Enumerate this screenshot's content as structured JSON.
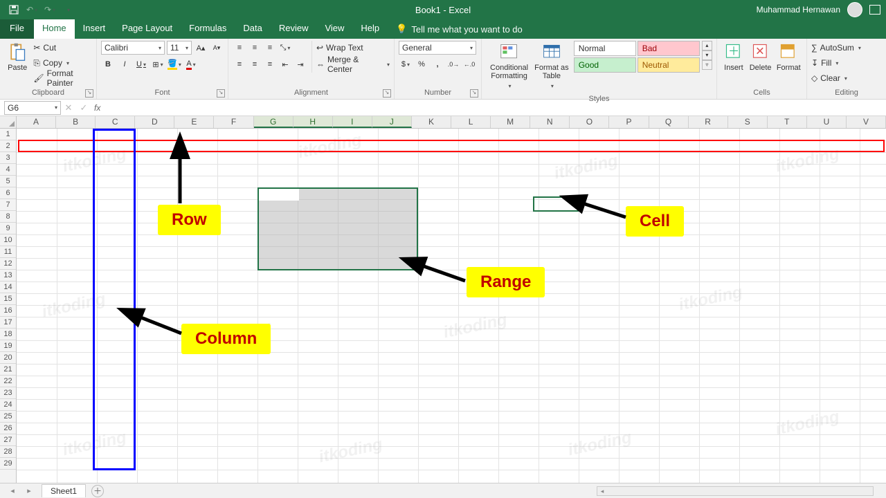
{
  "titlebar": {
    "document": "Book1  -  Excel",
    "user": "Muhammad Hernawan"
  },
  "tabs": {
    "file": "File",
    "list": [
      "Home",
      "Insert",
      "Page Layout",
      "Formulas",
      "Data",
      "Review",
      "View",
      "Help"
    ],
    "active": "Home",
    "tellme": "Tell me what you want to do"
  },
  "ribbon": {
    "clipboard": {
      "paste": "Paste",
      "cut": "Cut",
      "copy": "Copy",
      "painter": "Format Painter",
      "label": "Clipboard"
    },
    "font": {
      "name": "Calibri",
      "size": "11",
      "label": "Font"
    },
    "alignment": {
      "wrap": "Wrap Text",
      "merge": "Merge & Center",
      "label": "Alignment"
    },
    "number": {
      "format": "General",
      "label": "Number"
    },
    "styles": {
      "cond": "Conditional Formatting",
      "table": "Format as Table",
      "s1": "Normal",
      "s2": "Bad",
      "s3": "Good",
      "s4": "Neutral",
      "label": "Styles"
    },
    "cells": {
      "insert": "Insert",
      "delete": "Delete",
      "format": "Format",
      "label": "Cells"
    },
    "editing": {
      "autosum": "AutoSum",
      "fill": "Fill",
      "clear": "Clear",
      "label": "Editing"
    }
  },
  "formula": {
    "namebox": "G6"
  },
  "columns": [
    "A",
    "B",
    "C",
    "D",
    "E",
    "F",
    "G",
    "H",
    "I",
    "J",
    "K",
    "L",
    "M",
    "N",
    "O",
    "P",
    "Q",
    "R",
    "S",
    "T",
    "U",
    "V"
  ],
  "selected_cols": [
    "G",
    "H",
    "I",
    "J"
  ],
  "rows": [
    1,
    2,
    3,
    4,
    5,
    6,
    7,
    8,
    9,
    10,
    11,
    12,
    13,
    14,
    15,
    16,
    17,
    18,
    19,
    20,
    21,
    22,
    23,
    24,
    25,
    26,
    27,
    28,
    29
  ],
  "annotations": {
    "row": "Row",
    "column": "Column",
    "range": "Range",
    "cell": "Cell"
  },
  "sheet": {
    "tab1": "Sheet1"
  },
  "watermark": "itkoding"
}
